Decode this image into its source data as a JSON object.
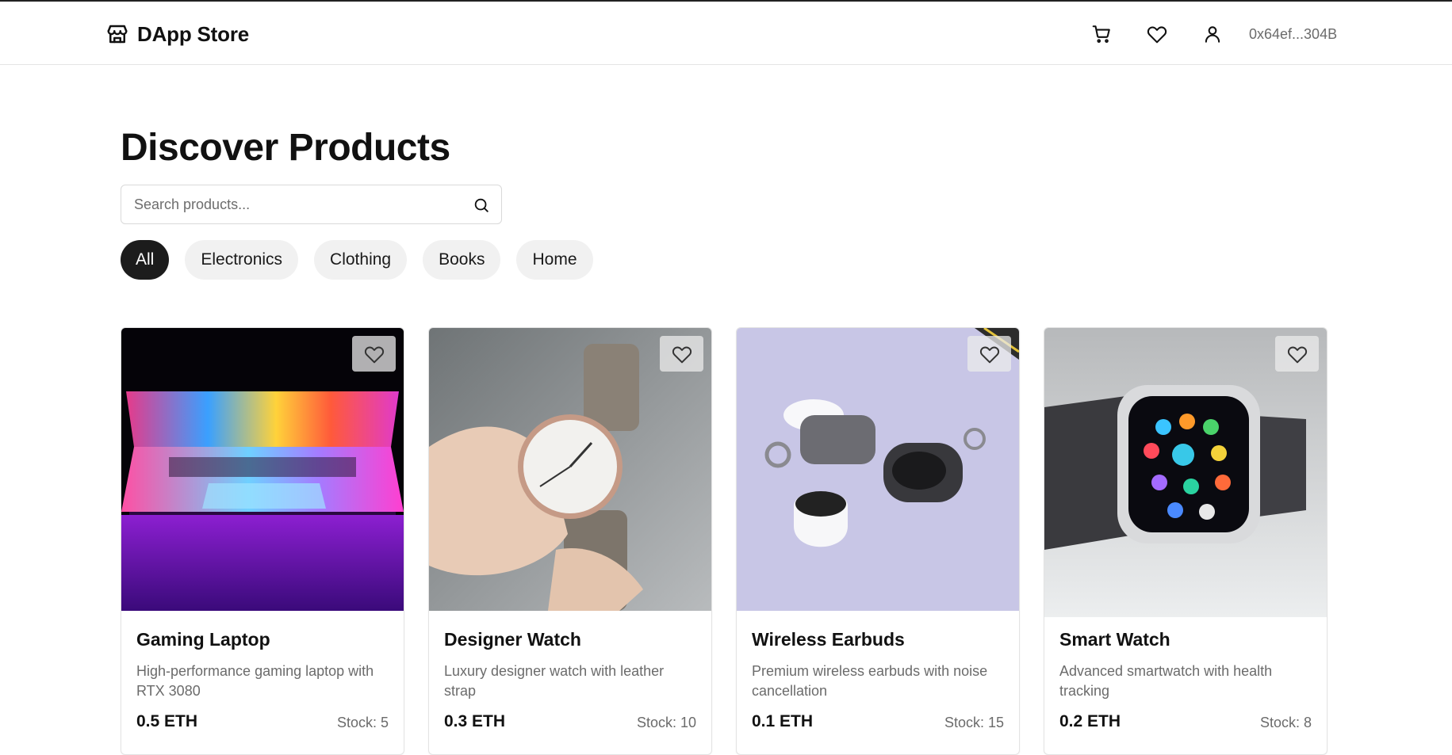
{
  "header": {
    "brand": "DApp Store",
    "icons": [
      "store-icon",
      "cart-icon",
      "heart-icon",
      "user-icon"
    ],
    "wallet_address": "0x64ef...304B"
  },
  "main": {
    "title": "Discover Products",
    "search": {
      "placeholder": "Search products...",
      "value": ""
    },
    "categories": [
      {
        "label": "All",
        "active": true
      },
      {
        "label": "Electronics",
        "active": false
      },
      {
        "label": "Clothing",
        "active": false
      },
      {
        "label": "Books",
        "active": false
      },
      {
        "label": "Home",
        "active": false
      }
    ],
    "products": [
      {
        "name": "Gaming Laptop",
        "description": "High-performance gaming laptop with RTX 3080",
        "price": "0.5 ETH",
        "stock": "Stock: 5"
      },
      {
        "name": "Designer Watch",
        "description": "Luxury designer watch with leather strap",
        "price": "0.3 ETH",
        "stock": "Stock: 10"
      },
      {
        "name": "Wireless Earbuds",
        "description": "Premium wireless earbuds with noise cancellation",
        "price": "0.1 ETH",
        "stock": "Stock: 15"
      },
      {
        "name": "Smart Watch",
        "description": "Advanced smartwatch with health tracking",
        "price": "0.2 ETH",
        "stock": "Stock: 8"
      }
    ]
  },
  "colors": {
    "active_chip": "#1c1c1c",
    "chip": "#f1f1f1",
    "muted_text": "#6b6b6b",
    "border": "#e3e3e3"
  }
}
